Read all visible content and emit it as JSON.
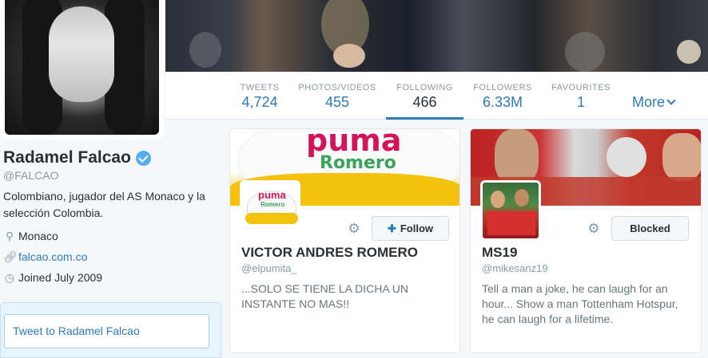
{
  "profile": {
    "name": "Radamel Falcao",
    "handle": "@FALCAO",
    "bio": "Colombiano, jugador del AS Monaco y la selección Colombia.",
    "location": "Monaco",
    "website": "falcao.com.co",
    "joined": "Joined July 2009",
    "verified": true
  },
  "nav": {
    "items": [
      {
        "label": "TWEETS",
        "value": "4,724"
      },
      {
        "label": "PHOTOS/VIDEOS",
        "value": "455"
      },
      {
        "label": "FOLLOWING",
        "value": "466"
      },
      {
        "label": "FOLLOWERS",
        "value": "6.33M"
      },
      {
        "label": "FAVOURITES",
        "value": "1"
      }
    ],
    "more": "More",
    "active": "FOLLOWING"
  },
  "tweet_box": {
    "placeholder": "Tweet to Radamel Falcao"
  },
  "cards": [
    {
      "name": "VICTOR ANDRES ROMERO",
      "handle": "@elpumita_",
      "bio": "...SOLO SE TIENE LA DICHA UN INSTANTE NO MAS!!",
      "button": "Follow",
      "banner_text_1": "puma",
      "banner_text_2": "Romero",
      "avatar_text_1": "puma",
      "avatar_text_2": "Romero"
    },
    {
      "name": "MS19",
      "handle": "@mikesanz19",
      "bio": "Tell a man a joke, he can laugh for an hour... Show a man Tottenham Hotspur, he can laugh for a lifetime.",
      "button": "Blocked"
    }
  ],
  "colors": {
    "accent": "#2b7bb9",
    "verified": "#55acee",
    "muted": "#8899a6"
  },
  "icons": {
    "location": "map-pin-icon",
    "website": "link-icon",
    "joined": "calendar-icon",
    "settings": "gear-icon",
    "follow": "add-user-icon"
  }
}
